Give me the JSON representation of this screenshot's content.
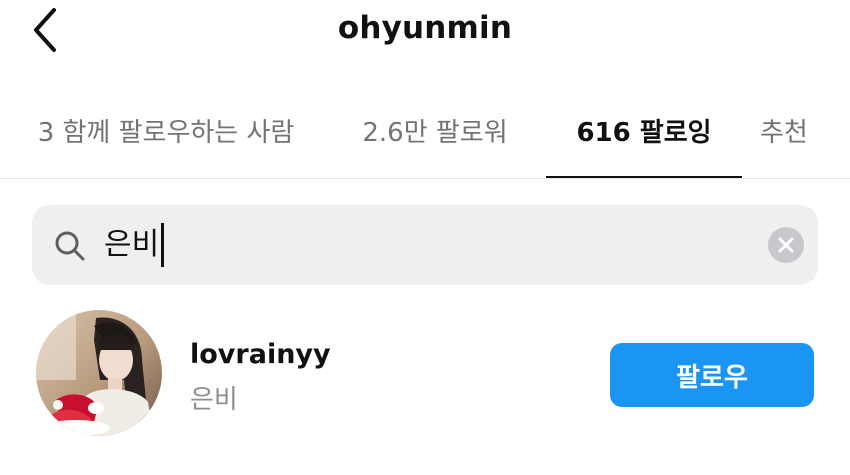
{
  "header": {
    "title": "ohyunmin",
    "back_icon": "chevron-left-icon"
  },
  "tabs": [
    {
      "label": "3 함께 팔로우하는 사람",
      "active": false
    },
    {
      "label": "2.6만 팔로워",
      "active": false
    },
    {
      "label": "616 팔로잉",
      "active": true
    },
    {
      "label": "추천",
      "active": false
    }
  ],
  "search": {
    "value": "은비",
    "icon": "search-icon",
    "clear_icon": "clear-icon"
  },
  "results": [
    {
      "username": "lovrainyy",
      "full_name": "은비",
      "button_label": "팔로우"
    }
  ],
  "colors": {
    "accent": "#1a95f3",
    "search_bg": "#efefef",
    "muted_text": "#8e8e8e",
    "tab_inactive": "#737373"
  }
}
